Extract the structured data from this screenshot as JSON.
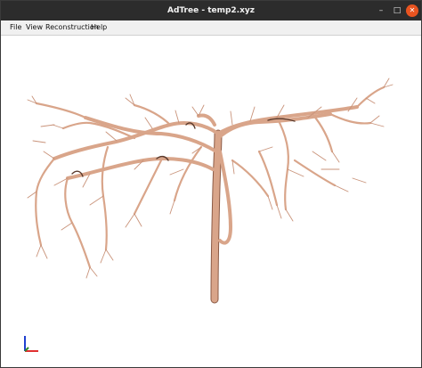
{
  "window": {
    "title": "AdTree - temp2.xyz"
  },
  "window_controls": {
    "minimize": "–",
    "maximize": "□",
    "close": "✕"
  },
  "menu": [
    {
      "label": "File"
    },
    {
      "label": "View"
    },
    {
      "label": "Reconstruction"
    },
    {
      "label": "Help"
    }
  ],
  "viewport": {
    "content": "3d-tree-model",
    "background": "#ffffff",
    "branch_color": "#d9a58a",
    "branch_shadow": "#8b5a45",
    "axis_colors": {
      "x": "#e03030",
      "y": "#2e8b2e",
      "z": "#2040d0"
    }
  }
}
